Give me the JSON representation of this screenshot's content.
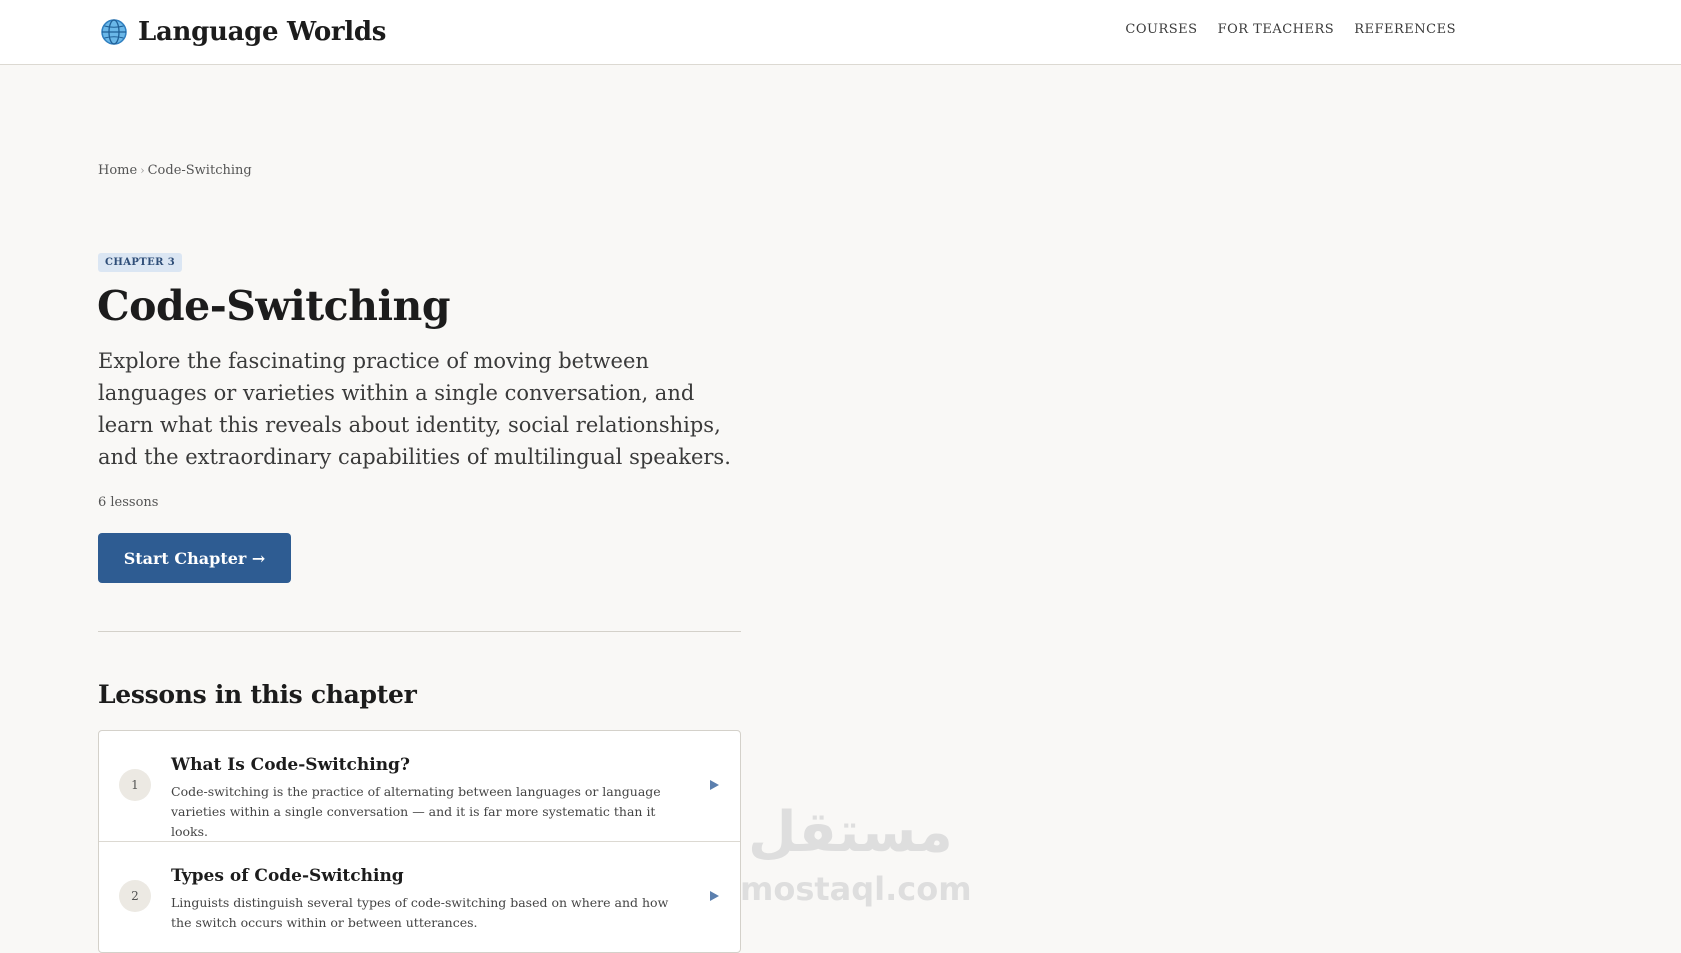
{
  "header": {
    "brand": "Language Worlds",
    "nav": [
      "COURSES",
      "FOR TEACHERS",
      "REFERENCES"
    ]
  },
  "breadcrumb": {
    "home": "Home",
    "separator": "›",
    "current": "Code-Switching"
  },
  "chapter": {
    "badge": "CHAPTER 3",
    "title": "Code-Switching",
    "intro": "Explore the fascinating practice of moving between languages or varieties within a single conversation, and learn what this reveals about identity, social relationships, and the extraordinary capabilities of multilingual speakers.",
    "lesson_count": "6 lessons",
    "start_label": "Start Chapter →"
  },
  "lessons": {
    "heading": "Lessons in this chapter",
    "items": [
      {
        "num": "1",
        "title": "What Is Code-Switching?",
        "desc": "Code-switching is the practice of alternating between languages or language varieties within a single conversation — and it is far more systematic than it looks."
      },
      {
        "num": "2",
        "title": "Types of Code-Switching",
        "desc": "Linguists distinguish several types of code-switching based on where and how the switch occurs within or between utterances."
      }
    ]
  },
  "watermark": {
    "arabic": "مستقل",
    "latin": "mostaql.com"
  },
  "colors": {
    "accent": "#2e5c92",
    "badge_bg": "#dbe6f3",
    "page_bg": "#f9f8f6"
  },
  "icons": {
    "brand": "globe-icon",
    "lesson_arrow": "play-arrow-icon"
  }
}
